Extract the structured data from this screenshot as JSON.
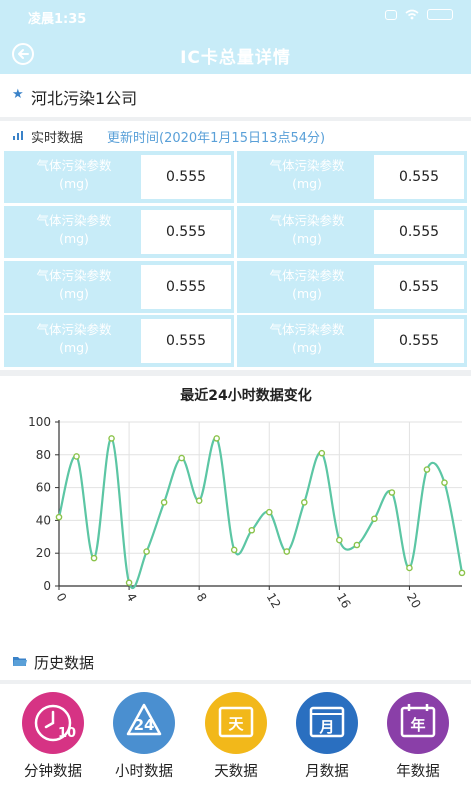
{
  "status_bar": {
    "time": "凌晨1:35"
  },
  "title_bar": {
    "title": "IC卡总量详情"
  },
  "company": {
    "name": "河北污染1公司"
  },
  "realtime": {
    "label": "实时数据",
    "update_time": "更新时间(2020年1月15日13点54分)",
    "cells": [
      {
        "label_line1": "气体污染参数",
        "label_line2": "(mg)",
        "value": "0.555"
      },
      {
        "label_line1": "气体污染参数",
        "label_line2": "(mg)",
        "value": "0.555"
      },
      {
        "label_line1": "气体污染参数",
        "label_line2": "(mg)",
        "value": "0.555"
      },
      {
        "label_line1": "气体污染参数",
        "label_line2": "(mg)",
        "value": "0.555"
      },
      {
        "label_line1": "气体污染参数",
        "label_line2": "(mg)",
        "value": "0.555"
      },
      {
        "label_line1": "气体污染参数",
        "label_line2": "(mg)",
        "value": "0.555"
      },
      {
        "label_line1": "气体污染参数",
        "label_line2": "(mg)",
        "value": "0.555"
      },
      {
        "label_line1": "气体污染参数",
        "label_line2": "(mg)",
        "value": "0.555"
      }
    ]
  },
  "chart_data": {
    "type": "line",
    "title": "最近24小时数据变化",
    "xlabel": "",
    "ylabel": "",
    "x": [
      0,
      1,
      2,
      3,
      4,
      5,
      6,
      7,
      8,
      9,
      10,
      11,
      12,
      13,
      14,
      15,
      16,
      17,
      18,
      19,
      20,
      21,
      22,
      23
    ],
    "values": [
      42,
      79,
      17,
      90,
      2,
      21,
      51,
      78,
      52,
      90,
      22,
      34,
      45,
      21,
      51,
      81,
      28,
      25,
      41,
      57,
      11,
      71,
      63,
      8
    ],
    "xlim": [
      0,
      23
    ],
    "ylim": [
      0,
      100
    ],
    "xticks": [
      "0",
      "4",
      "8",
      "12",
      "16",
      "20"
    ],
    "yticks": [
      "0",
      "20",
      "40",
      "60",
      "80",
      "100"
    ],
    "grid": true,
    "line_color": "#5cc6a4",
    "point_color": "#8bc34a"
  },
  "history": {
    "label": "历史数据",
    "buttons": [
      {
        "label": "分钟数据",
        "icon": "clock-10-icon",
        "color": "#d63384",
        "glyph": "10"
      },
      {
        "label": "小时数据",
        "icon": "recycle-24-icon",
        "color": "#4a8fd0",
        "glyph": "24"
      },
      {
        "label": "天数据",
        "icon": "calendar-day-icon",
        "color": "#f2b81a",
        "glyph": "天"
      },
      {
        "label": "月数据",
        "icon": "calendar-month-icon",
        "color": "#2a6fc0",
        "glyph": "月"
      },
      {
        "label": "年数据",
        "icon": "calendar-year-icon",
        "color": "#8a3fa8",
        "glyph": "年"
      }
    ]
  }
}
